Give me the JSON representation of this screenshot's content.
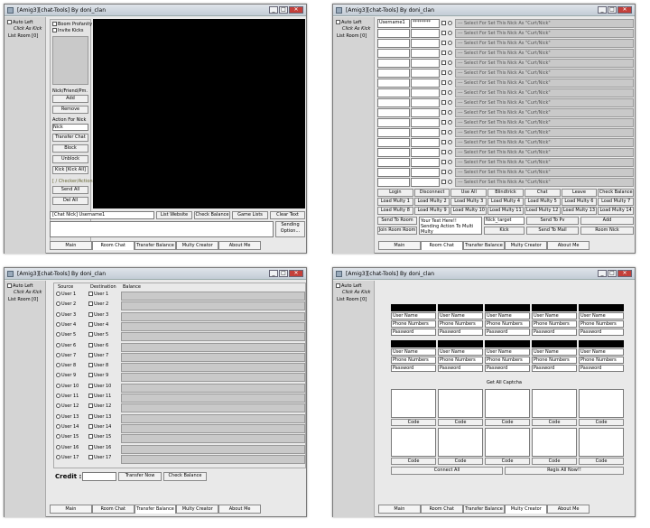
{
  "w1": {
    "title": "[Amig3][chat-Tools] By doni_clan",
    "auto_left": "Auto Left",
    "click_as_kick": "Click As Kick",
    "list_room": "List Room [0]",
    "boom_profanity": "Boom Profanity",
    "invite_kicks": "Invite Kicks",
    "nick_label": "Nick/Friend/Pm.",
    "add": "Add",
    "remove": "Remove",
    "action_header": "Action For Nick ",
    "nick": "Nick",
    "transfer_chat": "Transfer Chat",
    "block": "Block",
    "unblock": "Unblock",
    "kick_all": "Kick [Kick All]",
    "auto_label": "[ / Checker/Actions]",
    "send": "Send All",
    "delete": "Del All",
    "username_bar": "[Chat Nick] Username1",
    "btn1": "List Website",
    "btn2": "Check Balance",
    "btn3": "Game Lists",
    "btn4": "Clear Text",
    "sending": "Sending Option...",
    "tabs": [
      "Main",
      "Room Chat",
      "Transfer Balance",
      "Multy Creator",
      "About Me"
    ]
  },
  "w2": {
    "title": "[Amig3][chat-Tools] By doni_clan",
    "auto_left": "Auto Left",
    "click_as_kick": "Click As Kick",
    "list_room": "List Room [0]",
    "col_user": "Username1",
    "col_pass": "********",
    "select_text": "--- Select For Set This Nick As \"Curt/Nick\"",
    "bottom": [
      "Login",
      "Disconnect",
      "Use All",
      "Blindtrick",
      "Chat",
      "Leave",
      "Check Balance"
    ],
    "load": [
      "Load Multy 1",
      "Load Multy 2",
      "Load Multy 3",
      "Load Multy 4",
      "Load Multy 5",
      "Load Multy 6",
      "Load Multy 7",
      "Load Multy 8",
      "Load Multy 9",
      "Load Multy 10",
      "Load Multy 11",
      "Load Multy 12",
      "Load Multy 13",
      "Load Multy 14"
    ],
    "send_to_room": "Send To Room",
    "join_room": "Join Room Room",
    "text_here": "Your Text Here!!",
    "sending_action": "Sending Action To Multi Multy",
    "nick_target": "Nick_target",
    "send_to_pv": "Send To Pv",
    "add": "Add",
    "kick": "Kick",
    "send_to_mail": "Send To Mail",
    "room_nick": "Room Nick",
    "tabs": [
      "Main",
      "Room Chat",
      "Transfer Balance",
      "Multy Creator",
      "About Me"
    ]
  },
  "w3": {
    "title": "[Amig3][chat-Tools] By doni_clan",
    "auto_left": "Auto Left",
    "click_as_kick": "Click As Kick",
    "list_room": "List Room [0]",
    "col_source": "Source",
    "col_dest": "Destination",
    "col_balance": "Balance",
    "src": [
      "User 1",
      "User 2",
      "User 3",
      "User 4",
      "User 5",
      "User 6",
      "User 7",
      "User 8",
      "User 9",
      "User 10",
      "User 11",
      "User 12",
      "User 13",
      "User 14",
      "User 15",
      "User 16",
      "User 17"
    ],
    "dst": [
      "User 1",
      "User 2",
      "User 3",
      "User 4",
      "User 5",
      "User 6",
      "User 7",
      "User 8",
      "User 9",
      "User 10",
      "User 11",
      "User 12",
      "User 13",
      "User 14",
      "User 15",
      "User 16",
      "User 17"
    ],
    "credit": "Credit :",
    "transfer_now": "Transfer Now",
    "check_balance": "Check Balance",
    "tabs": [
      "Main",
      "Room Chat",
      "Transfer Balance",
      "Multy Creator",
      "About Me"
    ]
  },
  "w4": {
    "title": "[Amig3][chat-Tools] By doni_clan",
    "auto_left": "Auto Left",
    "click_as_kick": "Click As Kick",
    "list_room": "List Room [0]",
    "user_name": "User Name",
    "phone": "Phone Numbers",
    "password": "Password",
    "get_all": "Get All Captcha",
    "code": "Code",
    "connect_all": "Connect All",
    "register_all": "Regis All Now!!",
    "tabs": [
      "Main",
      "Room Chat",
      "Transfer Balance",
      "Multy Creator",
      "About Me"
    ]
  }
}
